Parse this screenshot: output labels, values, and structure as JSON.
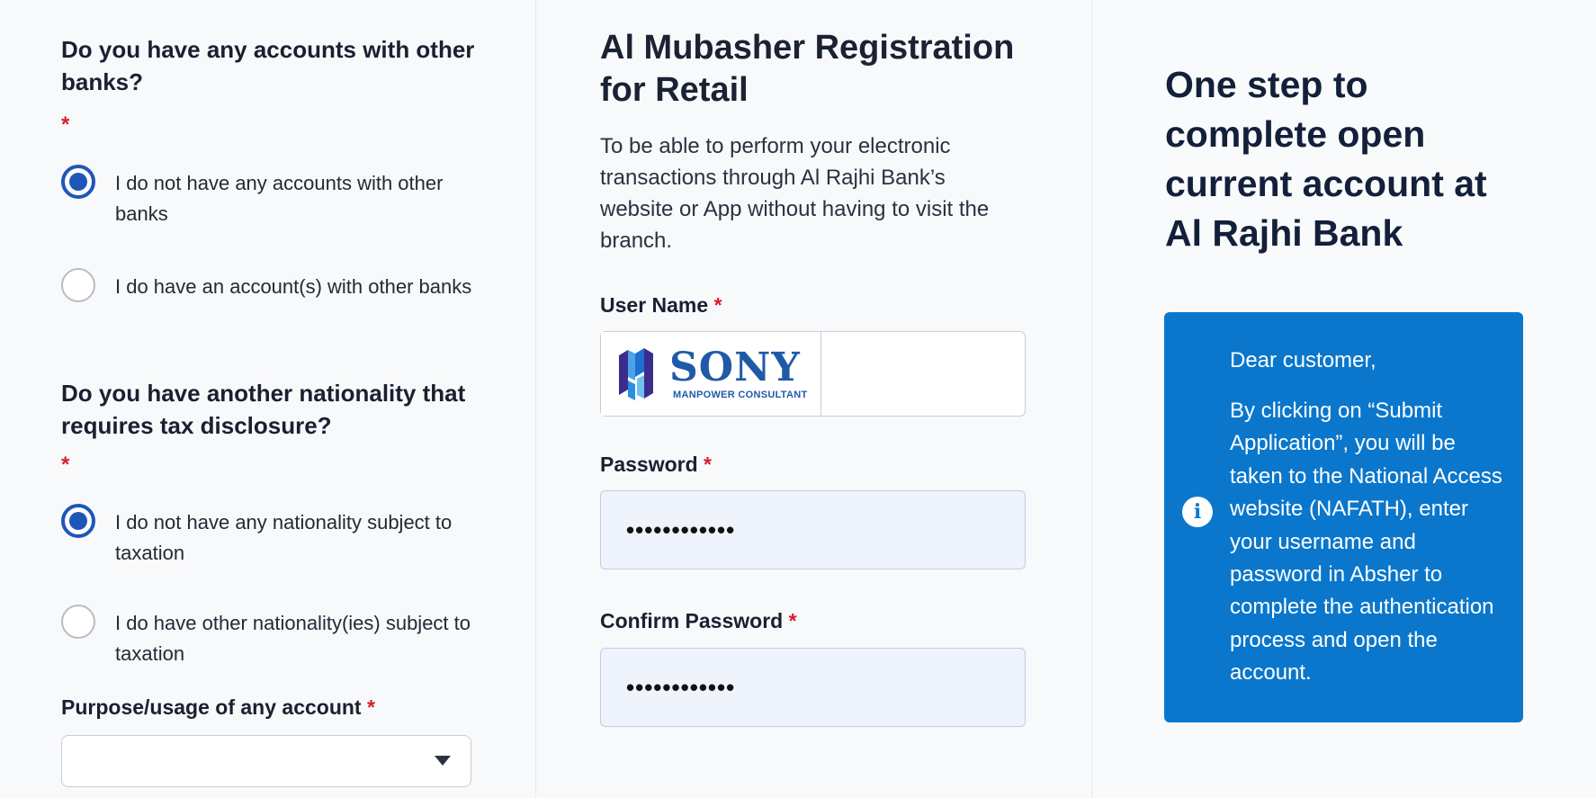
{
  "left": {
    "q1": {
      "title": "Do you have any accounts with other banks?",
      "star": "*",
      "options": [
        {
          "label": "I do not have any accounts with other banks",
          "checked": true
        },
        {
          "label": "I do have an account(s) with other banks",
          "checked": false
        }
      ]
    },
    "q2": {
      "title": "Do you have another nationality that requires tax disclosure?",
      "star": "*",
      "options": [
        {
          "label": "I do not have any nationality subject to taxation",
          "checked": true
        },
        {
          "label": "I do have other nationality(ies) subject to taxation",
          "checked": false
        }
      ]
    },
    "purpose": {
      "label": "Purpose/usage of any account",
      "star": "*",
      "value": ""
    }
  },
  "middle": {
    "title": "Al Mubasher Registration for Retail",
    "description": "To be able to perform your electronic transactions through Al Rajhi Bank’s website or App without having to visit the branch.",
    "username": {
      "label": "User Name",
      "star": "*",
      "logo_name": "SONY",
      "logo_sub": "MANPOWER CONSULTANT",
      "value": ""
    },
    "password": {
      "label": "Password",
      "star": "*",
      "value": "••••••••••••"
    },
    "confirm_password": {
      "label": "Confirm Password",
      "star": "*",
      "value": "••••••••••••"
    }
  },
  "right": {
    "title": "One step to complete open current account at Al Rajhi Bank",
    "info": {
      "icon": "info-icon",
      "icon_glyph": "i",
      "greeting": "Dear customer,",
      "body": "By clicking on “Submit Application”, you will be taken to the National Access website (NAFATH), enter your username and password in Absher to complete the authentication process and open the account."
    }
  },
  "colors": {
    "accent": "#1f57b8",
    "info_card": "#0a77cc",
    "required": "#d81e2b",
    "password_bg": "#eef3fc"
  }
}
